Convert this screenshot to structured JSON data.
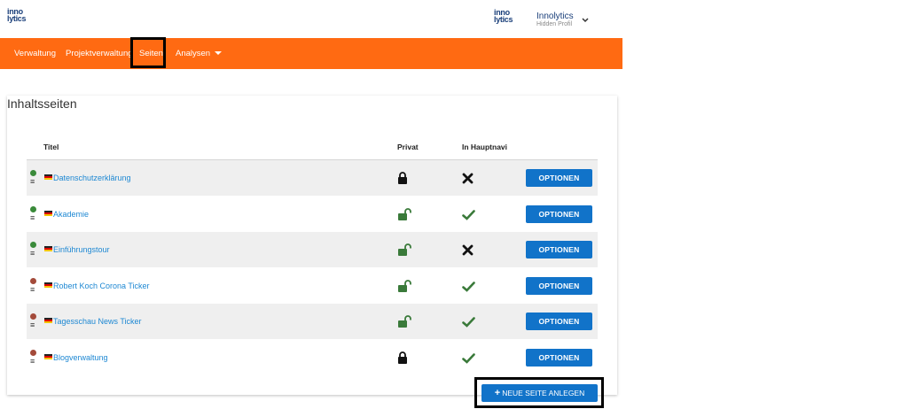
{
  "header": {
    "logo_lines": [
      "inno",
      "lytics"
    ],
    "profile": {
      "name": "Innolytics",
      "subtitle": "Hidden Profil"
    }
  },
  "nav": {
    "items": [
      {
        "label": "Verwaltung"
      },
      {
        "label": "Projektverwaltung"
      },
      {
        "label": "Seiten"
      },
      {
        "label": "Analysen"
      }
    ],
    "background_color": "#ff6a12"
  },
  "main": {
    "title": "Inhaltsseiten",
    "columns": [
      "Titel",
      "Privat",
      "In Hauptnavi"
    ],
    "rows": [
      {
        "title": "Datenschutzerklärung",
        "status_color": "#3a8a3a",
        "private": "locked",
        "hauptnavi": "no",
        "option_label": "OPTIONEN"
      },
      {
        "title": "Akademie",
        "status_color": "#3a8a3a",
        "private": "unlocked",
        "hauptnavi": "yes",
        "option_label": "OPTIONEN"
      },
      {
        "title": "Einführungstour",
        "status_color": "#3a8a3a",
        "private": "unlocked",
        "hauptnavi": "no",
        "option_label": "OPTIONEN"
      },
      {
        "title": "Robert Koch Corona Ticker",
        "status_color": "#a34a3a",
        "private": "unlocked",
        "hauptnavi": "yes",
        "option_label": "OPTIONEN"
      },
      {
        "title": "Tagesschau News Ticker",
        "status_color": "#a34a3a",
        "private": "unlocked",
        "hauptnavi": "yes",
        "option_label": "OPTIONEN"
      },
      {
        "title": "Blogverwaltung",
        "status_color": "#a34a3a",
        "private": "locked",
        "hauptnavi": "yes",
        "option_label": "OPTIONEN"
      }
    ],
    "new_page_label": "NEUE SEITE ANLEGEN",
    "accent_color": "#1173c9"
  }
}
